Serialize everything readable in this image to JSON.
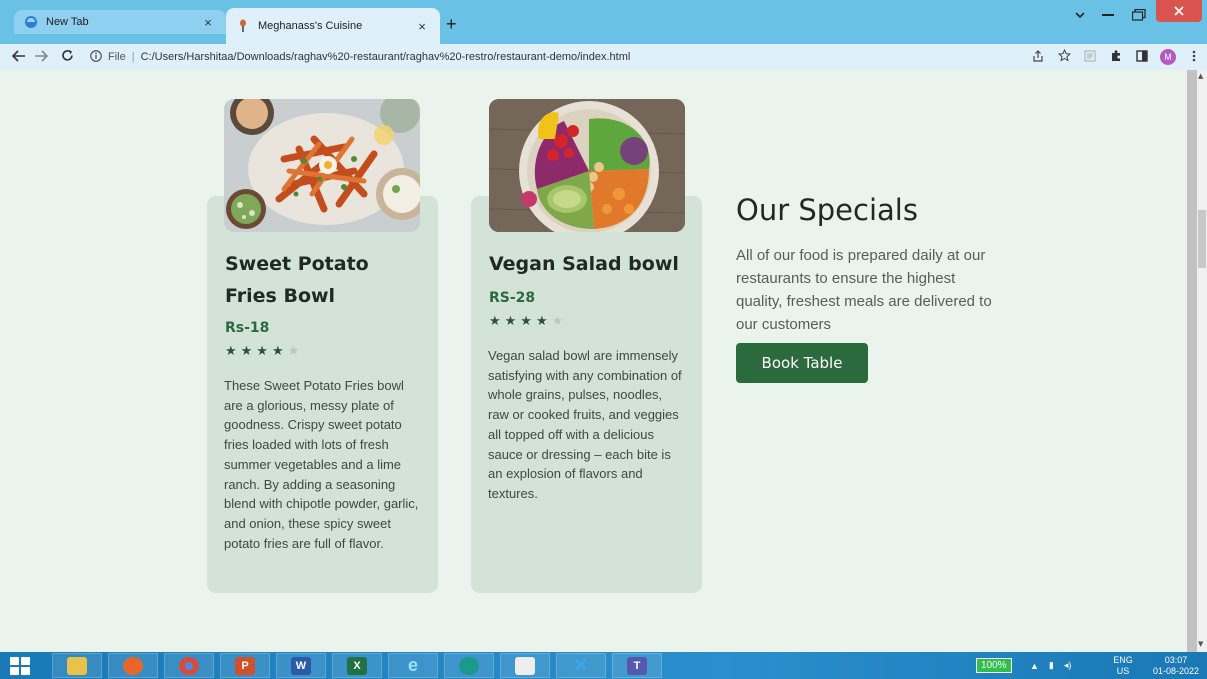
{
  "browser": {
    "tabs": [
      {
        "title": "New Tab",
        "close": "×"
      },
      {
        "title": "Meghanass's Cuisine",
        "close": "×"
      }
    ],
    "new_tab": "+",
    "address": {
      "scheme_label": "File",
      "url": "C:/Users/Harshitaa/Downloads/raghav%20-restaurant/raghav%20-restro/restaurant-demo/index.html"
    },
    "profile_initial": "M",
    "icons": {
      "back": "back-arrow-icon",
      "forward": "forward-arrow-icon",
      "reload": "reload-icon",
      "info": "info-icon",
      "share": "share-icon",
      "bookmark": "star-icon",
      "extensions": "puzzle-icon",
      "sidepanel": "side-panel-icon",
      "menu": "kebab-menu-icon"
    }
  },
  "cards": [
    {
      "title": "Sweet Potato Fries Bowl",
      "price": "Rs-18",
      "rating": 4,
      "stars_on": "★★★★",
      "stars_off": "★",
      "description": "These Sweet Potato Fries bowl are a glorious, messy plate of goodness. Crispy sweet potato fries loaded with lots of fresh summer vegetables and a lime ranch. By adding a seasoning blend with chipotle powder, garlic, and onion, these spicy sweet potato fries are full of flavor."
    },
    {
      "title": "Vegan Salad bowl",
      "price": "RS-28",
      "rating": 4,
      "stars_on": "★★★★",
      "stars_off": "★",
      "description": "Vegan salad bowl are immensely satisfying with any combination of whole grains, pulses, noodles, raw or cooked fruits, and veggies all topped off with a delicious sauce or dressing – each bite is an explosion of flavors and textures."
    }
  ],
  "specials": {
    "title": "Our Specials",
    "text": "All of our food is prepared daily at our restaurants to ensure the highest quality, freshest meals are delivered to our customers",
    "button": "Book Table"
  },
  "taskbar": {
    "battery": "100%",
    "lang_top": "ENG",
    "lang_bottom": "US",
    "time": "03:07",
    "date": "01-08-2022"
  },
  "colors": {
    "accent": "#2a6a3d",
    "card_bg": "#d3e3d7",
    "page_bg": "#eaf4ec"
  }
}
